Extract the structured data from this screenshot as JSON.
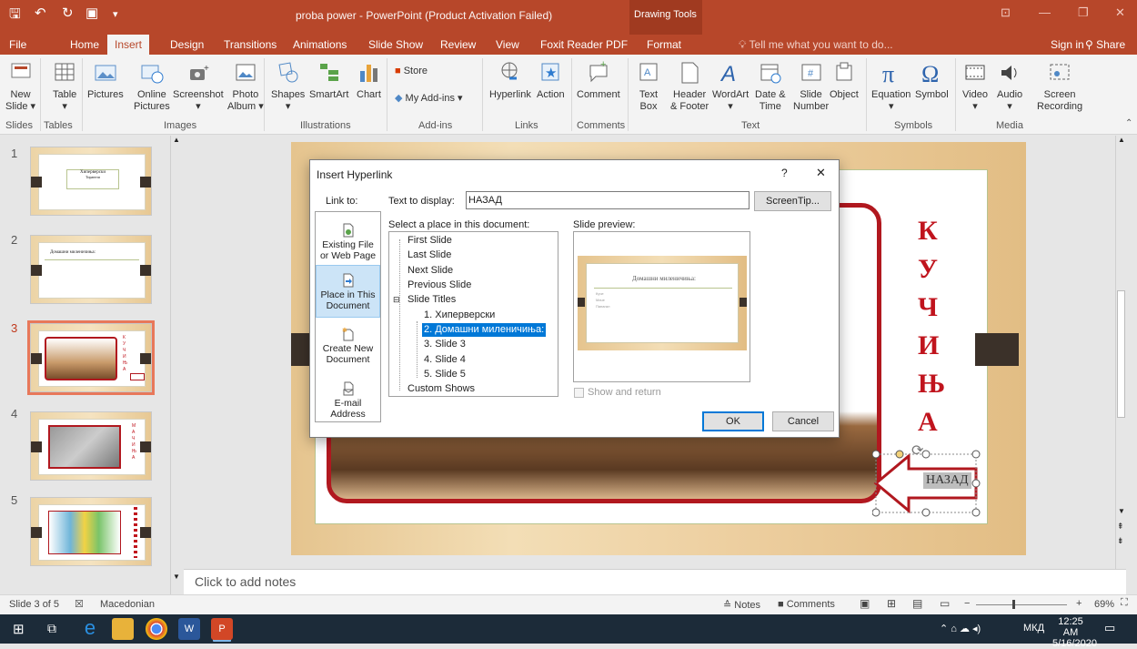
{
  "app": {
    "title": "proba power - PowerPoint (Product Activation Failed)",
    "context_tab_group": "Drawing Tools",
    "sign_in": "Sign in",
    "share": "Share",
    "tell_me": "Tell me what you want to do..."
  },
  "tabs": [
    "File",
    "Home",
    "Insert",
    "Design",
    "Transitions",
    "Animations",
    "Slide Show",
    "Review",
    "View",
    "Foxit Reader PDF",
    "Format"
  ],
  "active_tab": "Insert",
  "ribbon": {
    "slides_group": {
      "new_slide": "New",
      "new_slide2": "Slide",
      "label": "Slides"
    },
    "tables_group": {
      "table": "Table",
      "label": "Tables"
    },
    "images_group": {
      "pictures": "Pictures",
      "online1": "Online",
      "online2": "Pictures",
      "screenshot": "Screenshot",
      "photo1": "Photo",
      "photo2": "Album",
      "label": "Images"
    },
    "illustrations_group": {
      "shapes": "Shapes",
      "smartart": "SmartArt",
      "chart": "Chart",
      "label": "Illustrations"
    },
    "addins_group": {
      "store": "Store",
      "my_addins": "My Add-ins",
      "label": "Add-ins"
    },
    "links_group": {
      "hyperlink": "Hyperlink",
      "action": "Action",
      "label": "Links"
    },
    "comments_group": {
      "comment": "Comment",
      "label": "Comments"
    },
    "text_group": {
      "text1": "Text",
      "text2": "Box",
      "header1": "Header",
      "header2": "& Footer",
      "wordart": "WordArt",
      "date1": "Date &",
      "date2": "Time",
      "slide1": "Slide",
      "slide2": "Number",
      "object": "Object",
      "label": "Text"
    },
    "symbols_group": {
      "equation": "Equation",
      "symbol": "Symbol",
      "label": "Symbols"
    },
    "media_group": {
      "video": "Video",
      "audio": "Audio",
      "screen1": "Screen",
      "screen2": "Recording",
      "label": "Media"
    }
  },
  "thumbnails": [
    {
      "num": "1",
      "title": "Хиперверски",
      "sub": "Тиранeзи"
    },
    {
      "num": "2",
      "title": "Домашни миленичиња:"
    },
    {
      "num": "3"
    },
    {
      "num": "4"
    },
    {
      "num": "5"
    }
  ],
  "slide": {
    "letters": [
      "К",
      "У",
      "Ч",
      "И",
      "Њ",
      "А"
    ],
    "button_text": "НАЗАД"
  },
  "notes_placeholder": "Click to add notes",
  "status": {
    "slide_of": "Slide 3 of 5",
    "language": "Macedonian",
    "notes": "Notes",
    "comments": "Comments",
    "zoom": "69%"
  },
  "taskbar": {
    "lang": "МКД",
    "time": "12:25 AM",
    "date": "5/16/2020"
  },
  "dialog": {
    "title": "Insert Hyperlink",
    "help": "?",
    "close": "✕",
    "link_to": "Link to:",
    "text_to_display_label": "Text to display:",
    "text_to_display": "НАЗАД",
    "screentip": "ScreenTip...",
    "select_place_label": "Select a place in this document:",
    "slide_preview_label": "Slide preview:",
    "link_types": [
      {
        "line1": "Existing File",
        "line2": "or Web Page"
      },
      {
        "line1": "Place in This",
        "line2": "Document"
      },
      {
        "line1": "Create New",
        "line2": "Document"
      },
      {
        "line1": "E-mail",
        "line2": "Address"
      }
    ],
    "tree": {
      "first": "First Slide",
      "last": "Last Slide",
      "next": "Next Slide",
      "previous": "Previous Slide",
      "titles": "Slide Titles",
      "s1": "1. Хиперверски",
      "s2": "2. Домашни миленичиња:",
      "s3": "3. Slide 3",
      "s4": "4. Slide 4",
      "s5": "5. Slide 5",
      "custom": "Custom Shows"
    },
    "preview_title": "Домашни миленичиња:",
    "preview_bullets": [
      "Кучe",
      "Мачe",
      "Папагал"
    ],
    "show_and_return": "Show and return",
    "ok": "OK",
    "cancel": "Cancel"
  }
}
